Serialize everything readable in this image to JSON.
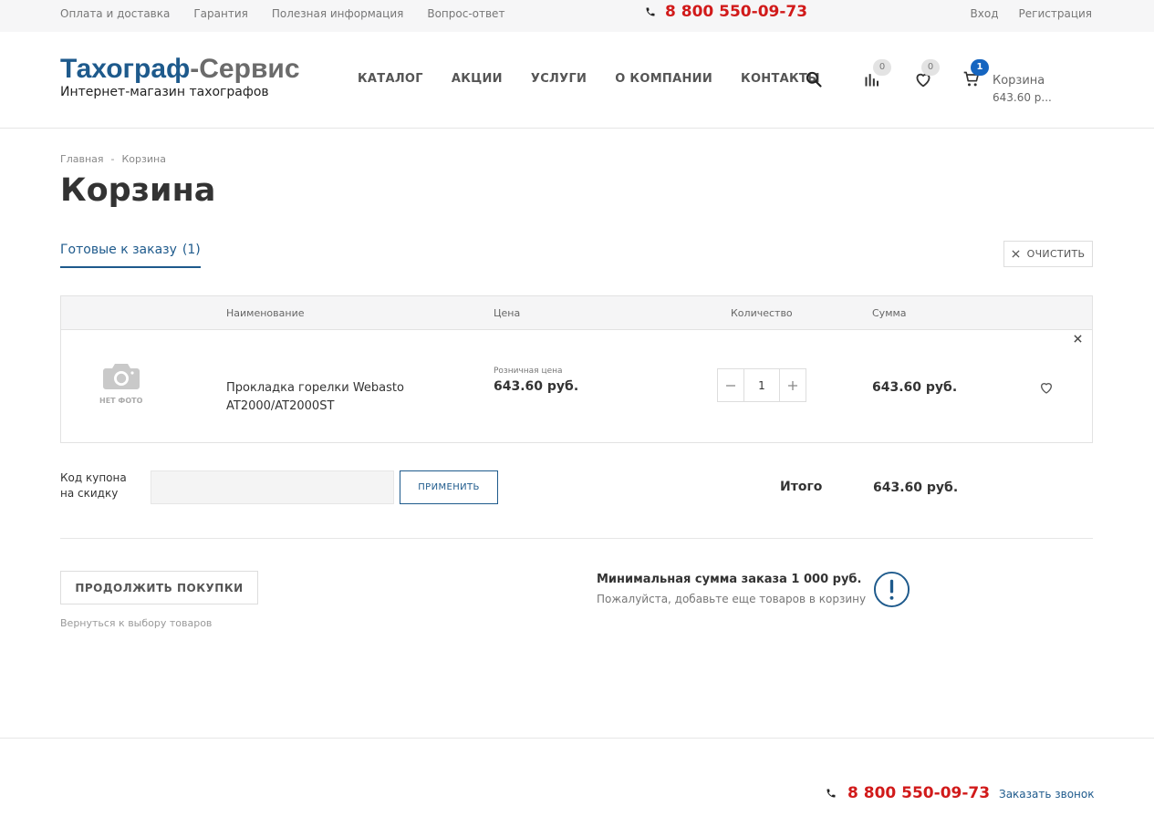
{
  "topbar": {
    "links": [
      "Оплата и доставка",
      "Гарантия",
      "Полезная информация",
      "Вопрос-ответ"
    ],
    "phone": "8 800 550-09-73",
    "login": "Вход",
    "register": "Регистрация"
  },
  "header": {
    "logo_part1": "Тахограф",
    "logo_part2": "-Сервис",
    "logo_sub": "Интернет-магазин тахографов",
    "nav": [
      "КАТАЛОГ",
      "АКЦИИ",
      "УСЛУГИ",
      "О КОМПАНИИ",
      "КОНТАКТЫ"
    ],
    "compare_count": "0",
    "favorites_count": "0",
    "cart_count": "1",
    "cart_label": "Корзина",
    "cart_sum": "643.60 р..."
  },
  "breadcrumb": {
    "home": "Главная",
    "sep": "-",
    "current": "Корзина"
  },
  "page_title": "Корзина",
  "tab": {
    "label": "Готовые к заказу",
    "count": "(1)"
  },
  "clear_button": "ОЧИСТИТЬ",
  "table": {
    "headers": {
      "name": "Наименование",
      "price": "Цена",
      "qty": "Количество",
      "sum": "Сумма"
    },
    "rows": [
      {
        "no_photo": "НЕТ ФОТО",
        "name": "Прокладка горелки Webasto AT2000/AT2000ST",
        "price_label": "Розничная цена",
        "price": "643.60 руб.",
        "qty": "1",
        "sum": "643.60 руб."
      }
    ]
  },
  "coupon": {
    "label_line1": "Код купона",
    "label_line2": "на скидку",
    "value": "",
    "apply_button": "ПРИМЕНИТЬ"
  },
  "total": {
    "label": "Итого",
    "value": "643.60 руб."
  },
  "continue": {
    "button": "ПРОДОЛЖИТЬ ПОКУПКИ",
    "hint": "Вернуться к выбору товаров"
  },
  "min_order": {
    "title": "Минимальная сумма заказа 1 000 руб.",
    "subtitle": "Пожалуйста, добавьте еще товаров в корзину"
  },
  "footer": {
    "phone": "8 800 550-09-73",
    "callback": "Заказать звонок"
  },
  "colors": {
    "accent": "#1e5a8c",
    "phone": "#d11a1a",
    "badge_active": "#1565c0"
  },
  "icons": [
    "phone-icon",
    "search-icon",
    "compare-icon",
    "heart-icon",
    "cart-icon",
    "camera-icon",
    "close-icon",
    "minus-icon",
    "plus-icon",
    "exclamation-circle-icon"
  ]
}
